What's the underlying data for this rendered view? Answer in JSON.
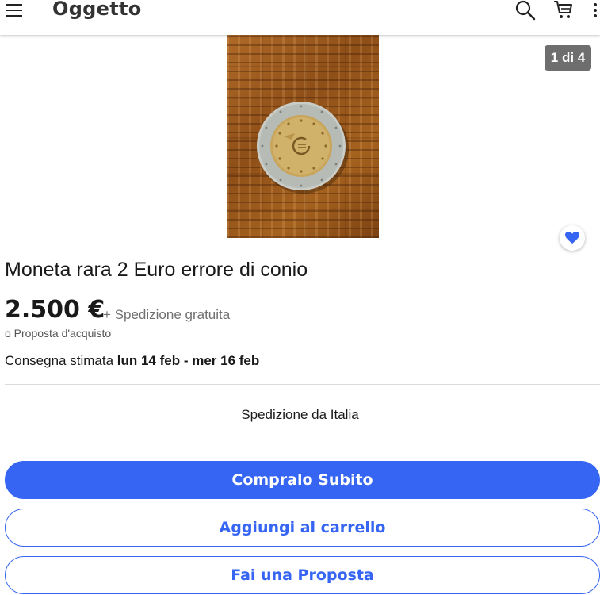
{
  "header": {
    "title": "Oggetto",
    "icons": [
      "menu-icon",
      "search-icon",
      "cart-icon",
      "more-vertical-icon"
    ]
  },
  "gallery": {
    "counter": "1 di 4"
  },
  "item": {
    "title": "Moneta rara 2 Euro errore di conio",
    "price": "2.500 €",
    "shipping": "+ Spedizione gratuita",
    "best_offer": "o Proposta d'acquisto",
    "delivery_label": "Consegna stimata",
    "delivery_dates": "lun 14 feb - mer 16 feb",
    "ships_from": "Spedizione da Italia"
  },
  "actions": {
    "buy_now": "Compralo Subito",
    "add_to_cart": "Aggiungi al carrello",
    "make_offer": "Fai una Proposta"
  },
  "colors": {
    "accent": "#3665f3",
    "badge_bg": "#6e6e6e",
    "text": "#191919"
  }
}
